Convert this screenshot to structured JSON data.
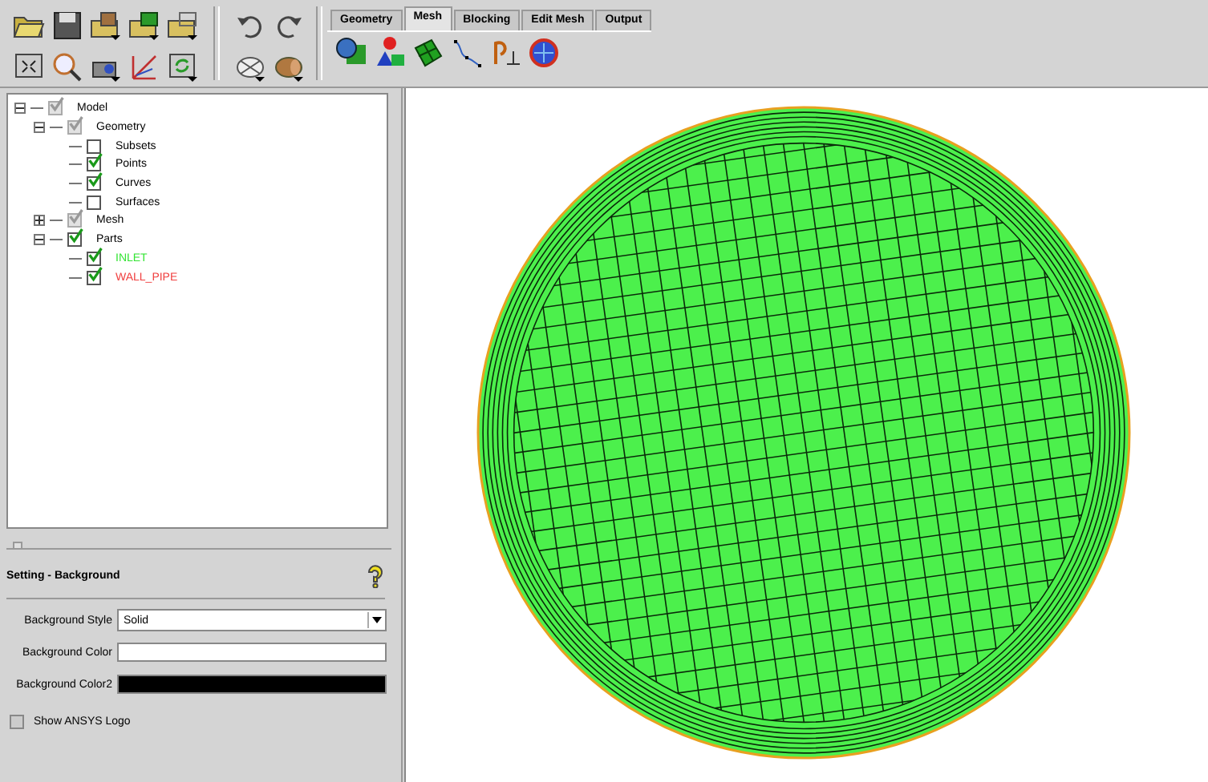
{
  "tabs": [
    {
      "label": "Geometry",
      "selected": false
    },
    {
      "label": "Mesh",
      "selected": true
    },
    {
      "label": "Blocking",
      "selected": false
    },
    {
      "label": "Edit Mesh",
      "selected": false
    },
    {
      "label": "Output",
      "selected": false
    }
  ],
  "tree": [
    {
      "label": "Model",
      "kind": "group",
      "expanded": true,
      "checked": true,
      "children": [
        {
          "label": "Geometry",
          "kind": "group",
          "expanded": true,
          "checked": true,
          "children": [
            {
              "label": "Subsets",
              "kind": "item",
              "checked": false
            },
            {
              "label": "Points",
              "kind": "item",
              "checked": true
            },
            {
              "label": "Curves",
              "kind": "item",
              "checked": true
            },
            {
              "label": "Surfaces",
              "kind": "item",
              "checked": false
            }
          ]
        },
        {
          "label": "Mesh",
          "kind": "group",
          "expanded": false,
          "checked": true
        },
        {
          "label": "Parts",
          "kind": "item",
          "expanded": true,
          "checked": true,
          "children": [
            {
              "label": "INLET",
              "kind": "item",
              "checked": true,
              "color": "#33e433"
            },
            {
              "label": "WALL_PIPE",
              "kind": "item",
              "checked": true,
              "color": "#f04040"
            }
          ]
        }
      ]
    }
  ],
  "settings": {
    "title": "Setting - Background",
    "fields": [
      {
        "label": "Background Style",
        "kind": "select",
        "value": "Solid"
      },
      {
        "label": "Background Color",
        "kind": "swatch",
        "color": "#ffffff"
      },
      {
        "label": "Background Color2",
        "kind": "swatch",
        "color": "#000000"
      }
    ],
    "logo_option": {
      "label": "Show ANSYS Logo",
      "checked": false
    }
  }
}
